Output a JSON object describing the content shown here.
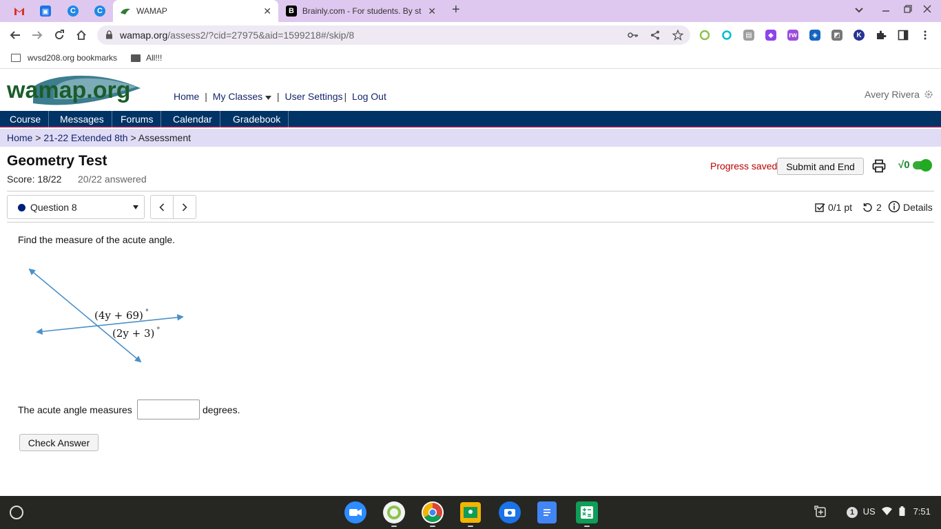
{
  "browser": {
    "tabs": [
      {
        "title": "WAMAP",
        "active": true
      },
      {
        "title": "Brainly.com - For students. By st",
        "active": false
      }
    ],
    "new_tab": "+",
    "close_glyph": "✕",
    "url_host": "wamap.org",
    "url_path": "/assess2/?cid=27975&aid=1599218#/skip/8"
  },
  "bookmarks": [
    {
      "label": "wvsd208.org bookmarks"
    },
    {
      "label": "All!!!"
    }
  ],
  "site": {
    "logo_text": "wamap.org",
    "toplinks": {
      "home": "Home",
      "sep1": "|",
      "my_classes": "My Classes",
      "sep2": "|",
      "settings": "User Settings",
      "sep3": "|",
      "logout": "Log Out"
    },
    "user_name": "Avery Rivera",
    "nav": [
      "Course",
      "Messages",
      "Forums",
      "Calendar",
      "Gradebook"
    ],
    "breadcrumb": {
      "home": "Home",
      "sep": ">",
      "course": "21-22 Extended 8th",
      "current": "Assessment"
    }
  },
  "assessment": {
    "title": "Geometry Test",
    "score": "Score: 18/22",
    "answered": "20/22 answered",
    "progress": "Progress saved",
    "submit_label": "Submit and End",
    "math_toggle": "√0",
    "question_select": "Question 8",
    "points": "0/1 pt",
    "retries": "2",
    "details": "Details"
  },
  "question": {
    "prompt": "Find the measure of the acute angle.",
    "label1": "(4y + 69)",
    "label2": "(2y + 3)",
    "degree": "°",
    "answer_before": "The acute angle measures",
    "answer_after": "degrees.",
    "answer_value": "",
    "check_label": "Check Answer"
  },
  "shelf": {
    "locale": "US",
    "notification_count": "1",
    "time": "7:51"
  },
  "colors": {
    "tabstrip": "#dfc8ef",
    "nav": "#003366",
    "breadcrumb": "#e0dcf5",
    "link": "#14256b",
    "saved": "#bb0000",
    "shelf": "#262622"
  }
}
